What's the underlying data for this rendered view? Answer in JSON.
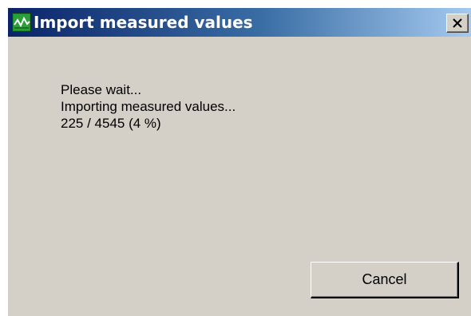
{
  "window": {
    "title": "Import measured values",
    "icon": "app-chart-icon",
    "close_icon": "close-icon",
    "title_gradient_start": "#0a246a",
    "title_gradient_end": "#a6caf0",
    "background": "#d4d0c8"
  },
  "message": {
    "line1": "Please wait...",
    "line2": "Importing measured values...",
    "progress_text": "225 / 4545 (4 %)"
  },
  "progress": {
    "current": 225,
    "total": 4545,
    "percent": 4
  },
  "buttons": {
    "cancel_label": "Cancel"
  }
}
